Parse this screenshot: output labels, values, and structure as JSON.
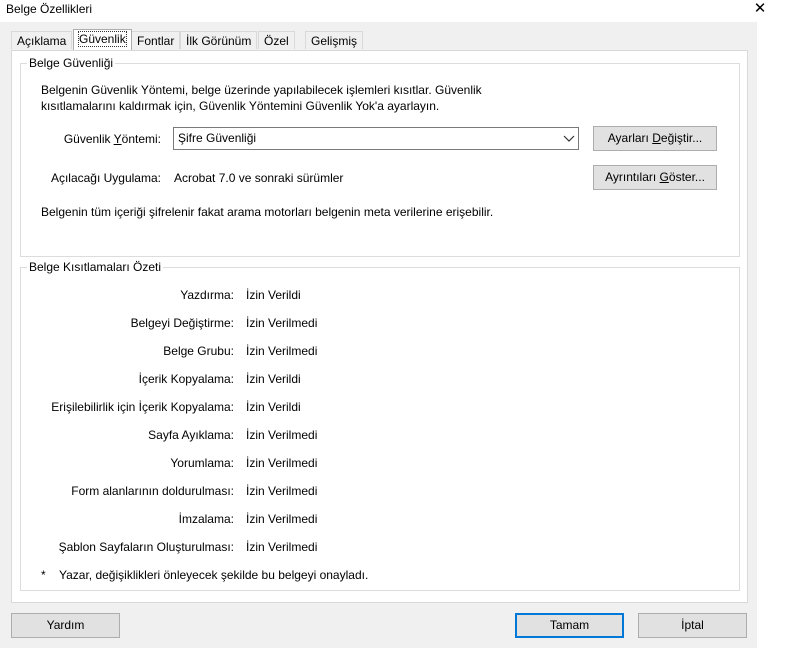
{
  "window": {
    "title": "Belge Özellikleri",
    "close_glyph": "✕"
  },
  "tabs": [
    {
      "label": "Açıklama",
      "active": false
    },
    {
      "label": "Güvenlik",
      "active": true
    },
    {
      "label": "Fontlar",
      "active": false
    },
    {
      "label": "İlk Görünüm",
      "active": false
    },
    {
      "label": "Özel",
      "active": false
    },
    {
      "label": "Gelişmiş",
      "active": false
    }
  ],
  "security": {
    "group_title": "Belge Güvenliği",
    "description_line1": "Belgenin Güvenlik Yöntemi, belge üzerinde yapılabilecek işlemleri kısıtlar. Güvenlik",
    "description_line2": "kısıtlamalarını kaldırmak için, Güvenlik Yöntemini Güvenlik Yok'a ayarlayın.",
    "method_label_pre": "Güvenlik ",
    "method_label_ul": "Y",
    "method_label_post": "öntemi:",
    "method_value": "Şifre Güvenliği",
    "settings_btn_pre": "Ayarları ",
    "settings_btn_ul": "D",
    "settings_btn_post": "eğiştir...",
    "app_label": "Açılacağı Uygulama:",
    "app_value": "Acrobat 7.0 ve sonraki sürümler",
    "details_btn_pre": "Ayrıntıları ",
    "details_btn_ul": "G",
    "details_btn_post": "öster...",
    "note": "Belgenin tüm içeriği şifrelenir fakat arama motorları belgenin meta verilerine erişebilir."
  },
  "restrictions": {
    "group_title": "Belge Kısıtlamaları Özeti",
    "rows": [
      {
        "label": "Yazdırma:",
        "value": "İzin Verildi"
      },
      {
        "label": "Belgeyi Değiştirme:",
        "value": "İzin Verilmedi"
      },
      {
        "label": "Belge Grubu:",
        "value": "İzin Verilmedi"
      },
      {
        "label": "İçerik Kopyalama:",
        "value": "İzin Verildi"
      },
      {
        "label": "Erişilebilirlik için İçerik Kopyalama:",
        "value": "İzin Verildi"
      },
      {
        "label": "Sayfa Ayıklama:",
        "value": "İzin Verilmedi"
      },
      {
        "label": "Yorumlama:",
        "value": "İzin Verilmedi"
      },
      {
        "label": "Form alanlarının doldurulması:",
        "value": "İzin Verilmedi"
      },
      {
        "label": "İmzalama:",
        "value": "İzin Verilmedi"
      },
      {
        "label": "Şablon Sayfaların Oluşturulması:",
        "value": "İzin Verilmedi"
      }
    ],
    "footnote_star": "*",
    "footnote": "Yazar, değişiklikleri önleyecek şekilde bu belgeyi onayladı."
  },
  "buttons": {
    "help": "Yardım",
    "ok": "Tamam",
    "cancel": "İptal"
  },
  "colors": {
    "dialog_bg": "#f0f0f0",
    "default_button_border": "#0078d7"
  }
}
